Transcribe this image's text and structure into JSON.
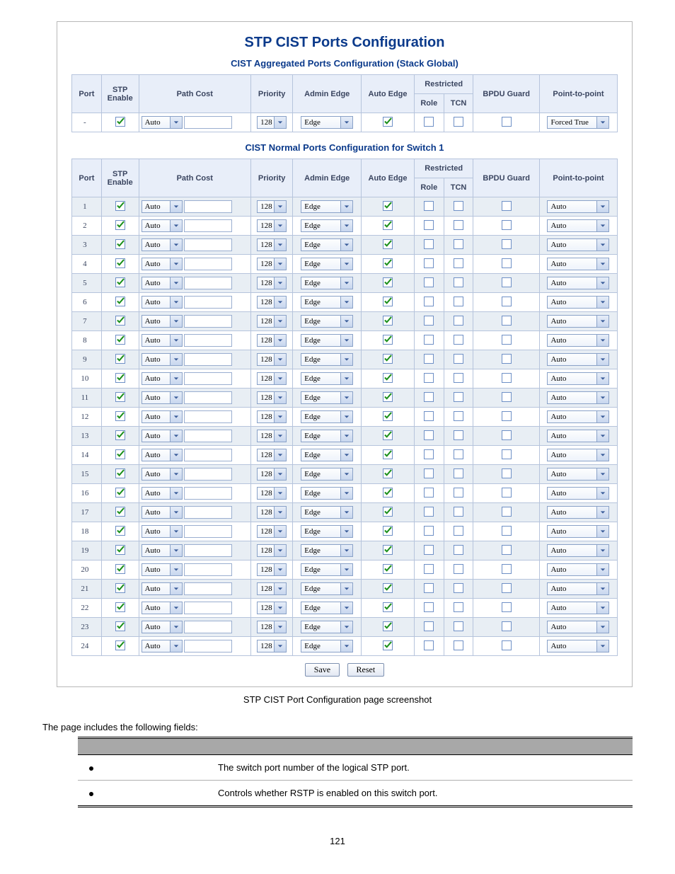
{
  "titles": {
    "main": "STP CIST Ports Configuration",
    "agg": "CIST Aggregated Ports Configuration (Stack Global)",
    "normal": "CIST Normal Ports Configuration for Switch 1"
  },
  "headers": {
    "port": "Port",
    "stp": "STP Enable",
    "path": "Path Cost",
    "priority": "Priority",
    "admin_edge": "Admin Edge",
    "auto_edge": "Auto Edge",
    "restricted": "Restricted",
    "role": "Role",
    "tcn": "TCN",
    "bpdu": "BPDU Guard",
    "ptp": "Point-to-point"
  },
  "agg_row": {
    "port": "-",
    "stp_enable": true,
    "path_mode": "Auto",
    "path_value": "",
    "priority": "128",
    "admin_edge": "Edge",
    "auto_edge": true,
    "role": false,
    "tcn": false,
    "bpdu": false,
    "ptp": "Forced True"
  },
  "port_defaults": {
    "stp_enable": true,
    "path_mode": "Auto",
    "path_value": "",
    "priority": "128",
    "admin_edge": "Edge",
    "auto_edge": true,
    "role": false,
    "tcn": false,
    "bpdu": false,
    "ptp": "Auto"
  },
  "port_count": 24,
  "buttons": {
    "save": "Save",
    "reset": "Reset"
  },
  "caption": "STP CIST Port Configuration page screenshot",
  "intro": "The page includes the following fields:",
  "fields": [
    {
      "desc": "The switch port number of the logical STP port."
    },
    {
      "desc": "Controls whether RSTP is enabled on this switch port."
    }
  ],
  "page_number": "121"
}
